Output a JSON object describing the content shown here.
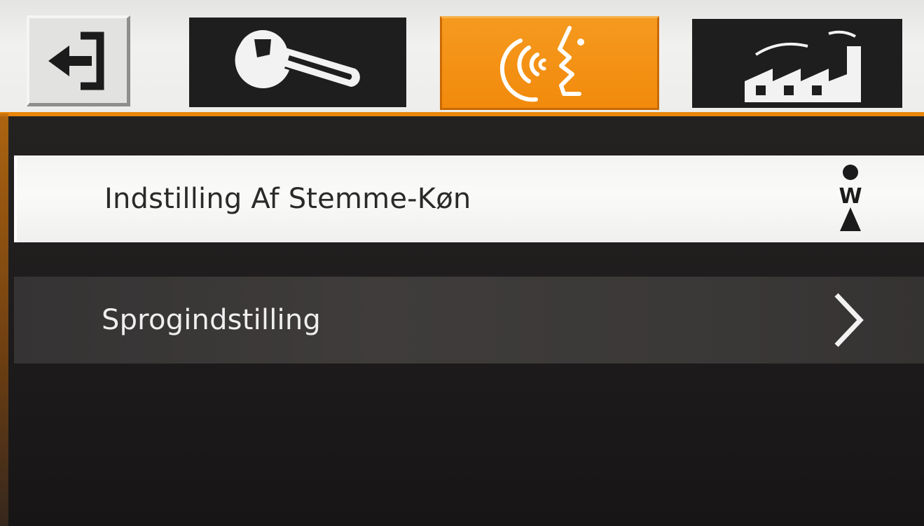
{
  "tabs": [
    {
      "id": "exit",
      "icon": "exit-icon",
      "active": false
    },
    {
      "id": "tools",
      "icon": "wrench-icon",
      "active": false
    },
    {
      "id": "voice",
      "icon": "voice-speech-icon",
      "active": true
    },
    {
      "id": "factory",
      "icon": "factory-icon",
      "active": false
    }
  ],
  "colors": {
    "accent": "#f28a0c",
    "tab_dark": "#1f1e1e",
    "panel_bg": "#1d1b1b",
    "row_selected_bg": "#f4f4f2",
    "row_bg": "#3a3837"
  },
  "menu": {
    "items": [
      {
        "label": "Indstilling Af Stemme-Køn",
        "icon": "voice-gender-icon",
        "gender_symbol": "W",
        "selected": true
      },
      {
        "label": "Sprogindstilling",
        "icon": "chevron-right-icon",
        "selected": false
      }
    ]
  }
}
